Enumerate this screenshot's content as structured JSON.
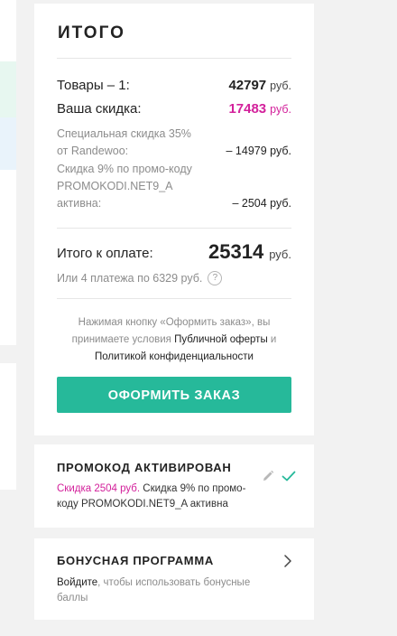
{
  "summary": {
    "title": "ИТОГО",
    "items_label": "Товары – 1:",
    "items_value": "42797",
    "currency": "руб.",
    "discount_label": "Ваша скидка:",
    "discount_value": "17483",
    "special_discount_label": "Специальная скидка 35% от Randewoo:",
    "special_discount_value": "– 14979 руб.",
    "promo_discount_label": "Скидка 9% по промо-коду PROMOKODI.NET9_A активна:",
    "promo_discount_value": "– 2504 руб.",
    "total_label": "Итого к оплате:",
    "total_value": "25314",
    "total_unit": "руб.",
    "installments_text": "Или 4 платежа по 6329 руб.",
    "help_glyph": "?",
    "disclaimer_part1": "Нажимая кнопку «Оформить заказ», вы принимаете условия",
    "disclaimer_link1": "Публичной оферты",
    "disclaimer_and": "и",
    "disclaimer_link2": "Политикой конфиденциальности",
    "order_button": "ОФОРМИТЬ ЗАКАЗ"
  },
  "promo": {
    "title": "ПРОМОКОД АКТИВИРОВАН",
    "discount_text": "Скидка 2504 руб.",
    "description": "Скидка 9% по промо-коду PROMOKODI.NET9_A активна"
  },
  "bonus": {
    "title": "БОНУСНАЯ ПРОГРАММА",
    "login_link": "Войдите",
    "text": ", чтобы использовать бонусные баллы"
  },
  "icons": {
    "pencil": "pencil-icon",
    "check": "check-icon",
    "chevron": "chevron-right-icon",
    "help": "question-icon"
  },
  "colors": {
    "accent": "#26b99a",
    "discount": "#d3219b"
  }
}
